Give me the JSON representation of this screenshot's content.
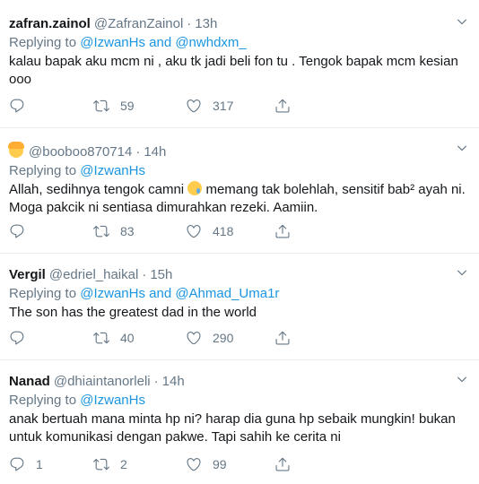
{
  "tweets": [
    {
      "name": "zafran.zainol",
      "handle": "@ZafranZainol",
      "time": "13h",
      "replying_prefix": "Replying to ",
      "replying_mentions": "@IzwanHs and @nwhdxm_",
      "text": "kalau bapak aku mcm ni , aku tk jadi beli fon tu . Tengok bapak mcm kesian ooo",
      "replies": "",
      "retweets": "59",
      "likes": "317"
    },
    {
      "name": "",
      "handle": "@booboo870714",
      "time": "14h",
      "replying_prefix": "Replying to ",
      "replying_mentions": "@IzwanHs",
      "text_part1": "Allah, sedihnya tengok camni ",
      "text_part2": " memang tak bolehlah, sensitif bab² ayah ni. Moga pakcik ni sentiasa dimurahkan rezeki. Aamiin.",
      "replies": "",
      "retweets": "83",
      "likes": "418"
    },
    {
      "name": "Vergil",
      "handle": "@edriel_haikal",
      "time": "15h",
      "replying_prefix": "Replying to ",
      "replying_mentions": "@IzwanHs and @Ahmad_Uma1r",
      "text": "The son has the greatest dad in the world",
      "replies": "",
      "retweets": "40",
      "likes": "290"
    },
    {
      "name": "Nanad",
      "handle": "@dhiaintanorleli",
      "time": "14h",
      "replying_prefix": "Replying to ",
      "replying_mentions": "@IzwanHs",
      "text": "anak bertuah mana minta hp ni? harap dia guna hp sebaik mungkin! bukan untuk komunikasi dengan pakwe. Tapi sahih ke cerita ni",
      "replies": "1",
      "retweets": "2",
      "likes": "99"
    }
  ],
  "separator": "·",
  "colors": {
    "link": "#1b95e0",
    "secondary": "#657786",
    "text": "#14171a",
    "border": "#e6ecf0"
  },
  "icons": [
    "reply-icon",
    "retweet-icon",
    "like-icon",
    "share-icon",
    "chevron-down-icon",
    "smiling-face-emoji",
    "sad-face-emoji"
  ]
}
